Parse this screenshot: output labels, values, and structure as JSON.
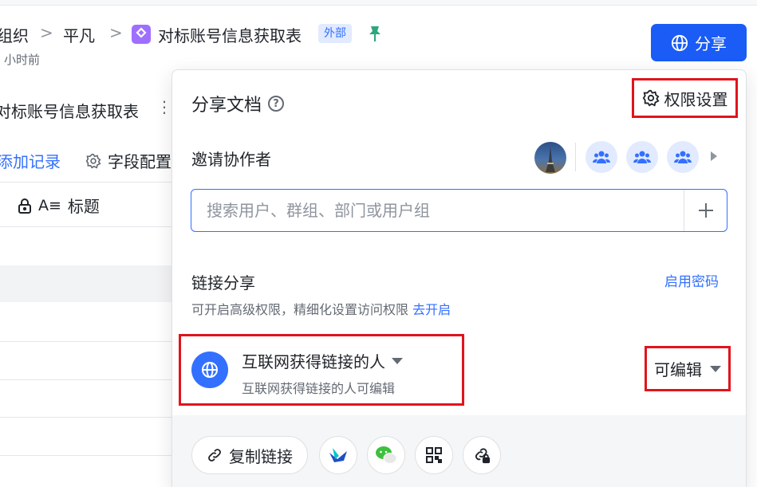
{
  "breadcrumb": {
    "items": [
      "组织",
      "平凡"
    ],
    "separator": ">",
    "doc_title": "对标账号信息获取表",
    "badge": "外部"
  },
  "doc_meta": {
    "updated": "小时前"
  },
  "header": {
    "share_label": "分享"
  },
  "table": {
    "title": "对标账号信息获取表",
    "add_record": "添加记录",
    "field_config": "字段配置",
    "column_title": "标题"
  },
  "share_panel": {
    "title": "分享文档",
    "permission_settings": "权限设置",
    "invite_label": "邀请协作者",
    "search_placeholder": "搜索用户、群组、部门或用户组",
    "link_share_label": "链接分享",
    "enable_password": "启用密码",
    "advanced_desc": "可开启高级权限，精细化设置访问权限",
    "advanced_link": "去开启",
    "scope_title": "互联网获得链接的人",
    "scope_desc": "互联网获得链接的人可编辑",
    "permission_level": "可编辑",
    "copy_link": "复制链接"
  },
  "colors": {
    "accent": "#3370ff",
    "share_button": "#1a5cf5",
    "highlight_box": "#e0141c",
    "pin": "#2ca77d"
  },
  "icons": [
    "pin-icon",
    "globe-icon",
    "help-icon",
    "gear-icon",
    "group-icon",
    "plus-icon",
    "link-icon",
    "feishu-icon",
    "wechat-icon",
    "qrcode-icon",
    "lock-link-icon",
    "lock-icon",
    "text-field-icon"
  ]
}
